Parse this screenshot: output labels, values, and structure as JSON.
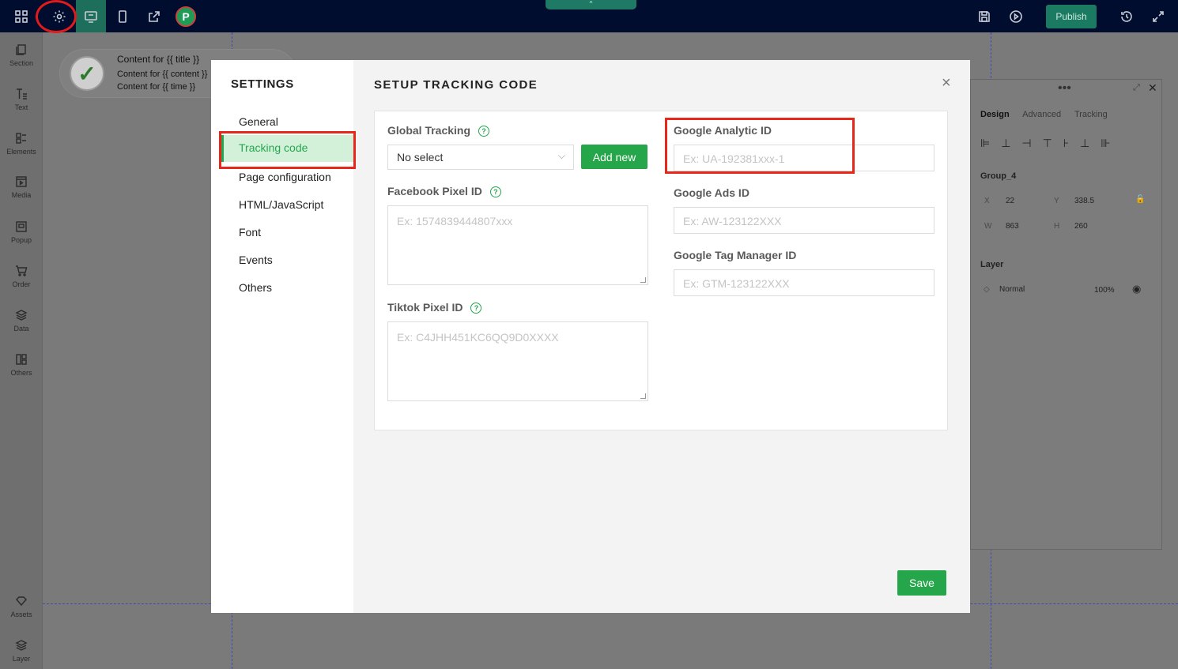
{
  "topbar": {
    "publish_label": "Publish",
    "avatar_letter": "P"
  },
  "leftbar": {
    "items": [
      {
        "label": "Section"
      },
      {
        "label": "Text"
      },
      {
        "label": "Elements"
      },
      {
        "label": "Media"
      },
      {
        "label": "Popup"
      },
      {
        "label": "Order"
      },
      {
        "label": "Data"
      },
      {
        "label": "Others"
      },
      {
        "label": "Assets"
      },
      {
        "label": "Layer"
      }
    ]
  },
  "canvas": {
    "card_title": "Content for {{ title }}",
    "card_content": "Content for {{ content }}",
    "card_time": "Content for {{ time }}"
  },
  "right_panel": {
    "tabs": [
      "Design",
      "Advanced",
      "Tracking"
    ],
    "group_name": "Group_4",
    "x_label": "X",
    "x_value": "22",
    "y_label": "Y",
    "y_value": "338.5",
    "w_label": "W",
    "w_value": "863",
    "h_label": "H",
    "h_value": "260",
    "layer_title": "Layer",
    "blend_mode": "Normal",
    "opacity": "100%"
  },
  "modal": {
    "settings_title": "SETTINGS",
    "nav": [
      "General",
      "Tracking code",
      "Page configuration",
      "HTML/JavaScript",
      "Font",
      "Events",
      "Others"
    ],
    "main_title": "SETUP TRACKING CODE",
    "close_glyph": "×",
    "global_tracking_label": "Global Tracking",
    "global_tracking_value": "No select",
    "add_new_label": "Add new",
    "facebook_label": "Facebook Pixel ID",
    "facebook_placeholder": "Ex: 1574839444807xxx",
    "tiktok_label": "Tiktok Pixel ID",
    "tiktok_placeholder": "Ex: C4JHH451KC6QQ9D0XXXX",
    "ga_label": "Google Analytic ID",
    "ga_placeholder": "Ex: UA-192381xxx-1",
    "ads_label": "Google Ads ID",
    "ads_placeholder": "Ex: AW-123122XXX",
    "gtm_label": "Google Tag Manager ID",
    "gtm_placeholder": "Ex: GTM-123122XXX",
    "save_label": "Save",
    "help_glyph": "?"
  }
}
